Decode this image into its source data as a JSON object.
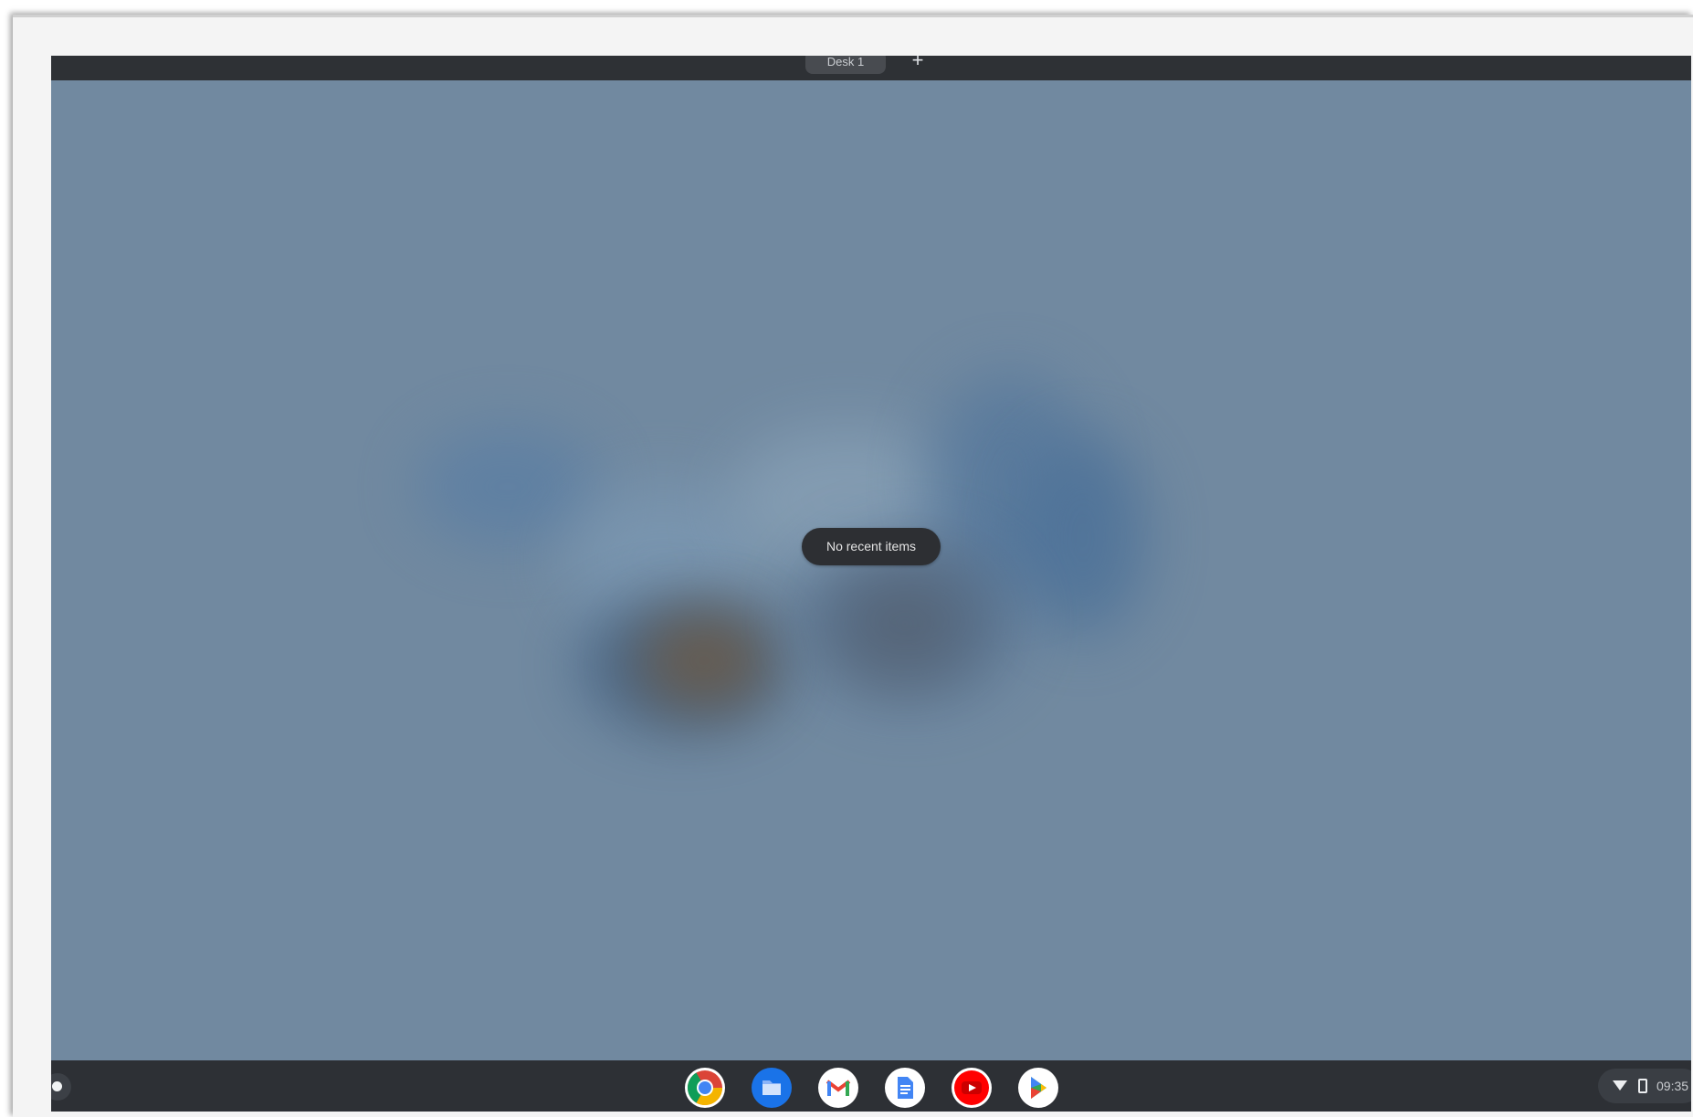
{
  "desks_bar": {
    "desk_label": "Desk 1",
    "new_desk_icon": "plus-icon"
  },
  "overview": {
    "empty_message": "No recent items"
  },
  "shelf": {
    "launcher_icon": "launcher-icon",
    "apps": [
      {
        "name": "Chrome",
        "icon": "chrome-icon"
      },
      {
        "name": "Files",
        "icon": "files-icon"
      },
      {
        "name": "Gmail",
        "icon": "gmail-icon"
      },
      {
        "name": "Docs",
        "icon": "docs-icon"
      },
      {
        "name": "YouTube",
        "icon": "youtube-icon"
      },
      {
        "name": "Play Store",
        "icon": "play-store-icon"
      }
    ],
    "status": {
      "wifi_icon": "wifi-icon",
      "battery_icon": "battery-icon",
      "time": "09:35"
    }
  },
  "colors": {
    "wallpaper": "#7189a0",
    "shelf": "#2d3035",
    "desk_bar": "#2e3135",
    "toast": "#2d2f33"
  }
}
